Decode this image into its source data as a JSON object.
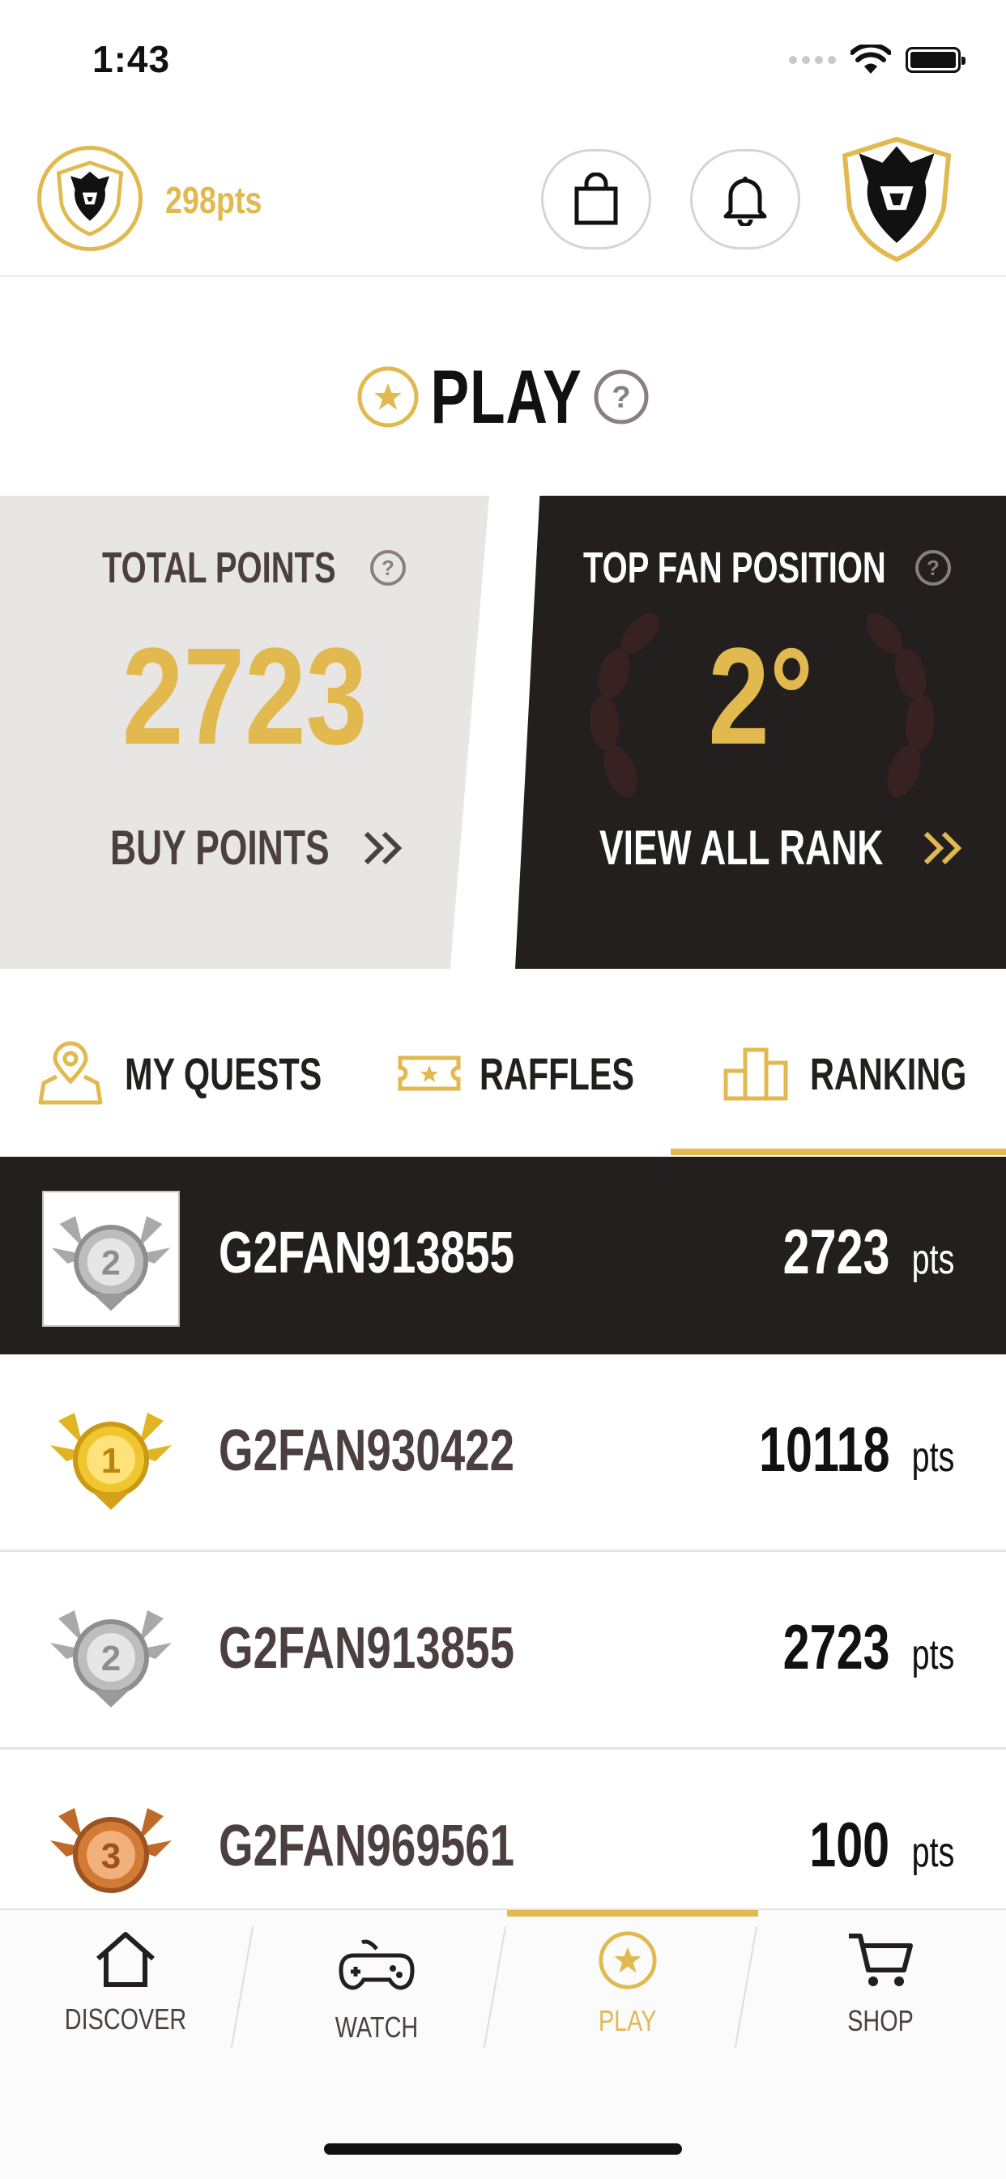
{
  "status_bar": {
    "time": "1:43"
  },
  "header": {
    "points": "298pts"
  },
  "page": {
    "title": "PLAY"
  },
  "stats": {
    "total_points_label": "TOTAL POINTS",
    "total_points_value": "2723",
    "buy_points_label": "BUY POINTS",
    "top_fan_label": "TOP FAN POSITION",
    "top_fan_value": "2°",
    "view_all_label": "VIEW ALL RANK"
  },
  "tabs": [
    {
      "label": "MY QUESTS",
      "active": false
    },
    {
      "label": "RAFFLES",
      "active": false
    },
    {
      "label": "RANKING",
      "active": true
    }
  ],
  "ranking": [
    {
      "medal": "silver-medal-2",
      "name": "G2FAN913855",
      "points": "2723",
      "unit": "pts",
      "is_me": true
    },
    {
      "medal": "gold-medal-1",
      "name": "G2FAN930422",
      "points": "10118",
      "unit": "pts",
      "is_me": false
    },
    {
      "medal": "silver-medal-2",
      "name": "G2FAN913855",
      "points": "2723",
      "unit": "pts",
      "is_me": false
    },
    {
      "medal": "bronze-medal-3",
      "name": "G2FAN969561",
      "points": "100",
      "unit": "pts",
      "is_me": false
    }
  ],
  "bottom_nav": [
    {
      "label": "DISCOVER",
      "icon": "home-icon",
      "active": false
    },
    {
      "label": "WATCH",
      "icon": "gamepad-icon",
      "active": false
    },
    {
      "label": "PLAY",
      "icon": "star-circle-icon",
      "active": true
    },
    {
      "label": "SHOP",
      "icon": "cart-icon",
      "active": false
    }
  ],
  "colors": {
    "gold": "#e1b94f",
    "dark": "#231f1f",
    "light_card": "#e8e5e5"
  }
}
